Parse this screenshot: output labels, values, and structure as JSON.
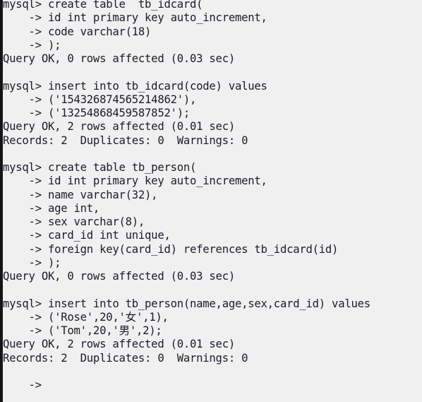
{
  "terminal": {
    "title": "mysql-console",
    "background_color": "#f0f0f0",
    "text_color": "#1b1b2b",
    "border_color": "#141414",
    "prompt": "mysql>",
    "continuation_prompt": "->",
    "lines": [
      "mysql> create table  tb_idcard(",
      "    -> id int primary key auto_increment,",
      "    -> code varchar(18)",
      "    -> );",
      "Query OK, 0 rows affected (0.03 sec)",
      "",
      "mysql> insert into tb_idcard(code) values",
      "    -> ('154326874565214862'),",
      "    -> ('13254868459587852');",
      "Query OK, 2 rows affected (0.01 sec)",
      "Records: 2  Duplicates: 0  Warnings: 0",
      "",
      "mysql> create table tb_person(",
      "    -> id int primary key auto_increment,",
      "    -> name varchar(32),",
      "    -> age int,",
      "    -> sex varchar(8),",
      "    -> card_id int unique,",
      "    -> foreign key(card_id) references tb_idcard(id)",
      "    -> );",
      "Query OK, 0 rows affected (0.03 sec)",
      "",
      "mysql> insert into tb_person(name,age,sex,card_id) values",
      "    -> ('Rose',20,'女',1),",
      "    -> ('Tom',20,'男',2);",
      "Query OK, 2 rows affected (0.01 sec)",
      "Records: 2  Duplicates: 0  Warnings: 0",
      "",
      "    ->"
    ]
  }
}
